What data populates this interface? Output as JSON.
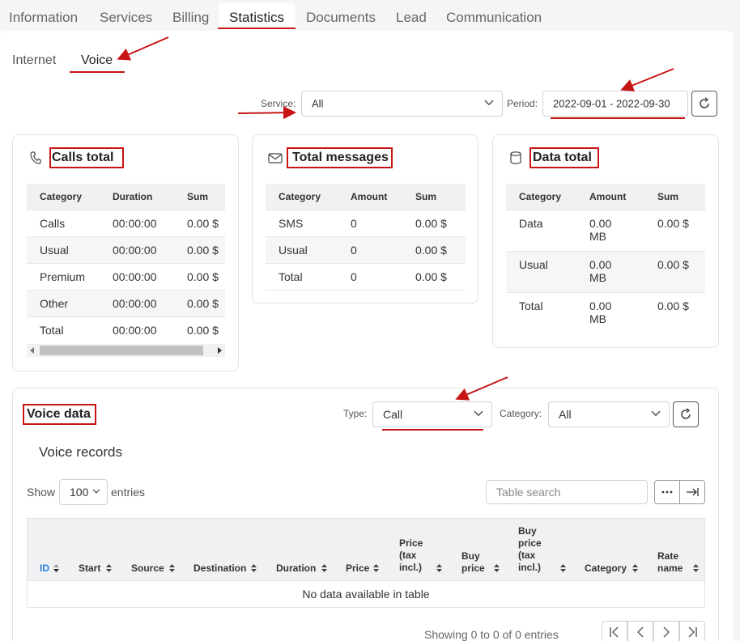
{
  "top_tabs": [
    "Information",
    "Services",
    "Billing",
    "Statistics",
    "Documents",
    "Lead",
    "Communication"
  ],
  "sub_tabs": [
    "Internet",
    "Voice"
  ],
  "filters": {
    "service_label": "Service:",
    "service_value": "All",
    "period_label": "Period:",
    "period_value": "2022-09-01 - 2022-09-30"
  },
  "calls_card": {
    "title": "Calls total",
    "icon": "phone-icon",
    "headers": [
      "Category",
      "Duration",
      "Sum"
    ],
    "rows": [
      [
        "Calls",
        "00:00:00",
        "0.00 $"
      ],
      [
        "Usual",
        "00:00:00",
        "0.00 $"
      ],
      [
        "Premium",
        "00:00:00",
        "0.00 $"
      ],
      [
        "Other",
        "00:00:00",
        "0.00 $"
      ],
      [
        "Total",
        "00:00:00",
        "0.00 $"
      ]
    ]
  },
  "messages_card": {
    "title": "Total messages",
    "icon": "envelope-icon",
    "headers": [
      "Category",
      "Amount",
      "Sum"
    ],
    "rows": [
      [
        "SMS",
        "0",
        "0.00 $"
      ],
      [
        "Usual",
        "0",
        "0.00 $"
      ],
      [
        "Total",
        "0",
        "0.00 $"
      ]
    ]
  },
  "data_card": {
    "title": "Data total",
    "icon": "database-icon",
    "headers": [
      "Category",
      "Amount",
      "Sum"
    ],
    "rows": [
      [
        "Data",
        "0.00 MB",
        "0.00 $"
      ],
      [
        "Usual",
        "0.00 MB",
        "0.00 $"
      ],
      [
        "Total",
        "0.00 MB",
        "0.00 $"
      ]
    ]
  },
  "voice_data": {
    "title": "Voice data",
    "type_label": "Type:",
    "type_value": "Call",
    "category_label": "Category:",
    "category_value": "All",
    "records_title": "Voice records",
    "show_label": "Show",
    "show_value": "100",
    "entries_label": "entries",
    "search_placeholder": "Table search",
    "columns": [
      "ID",
      "Start",
      "Source",
      "Destination",
      "Duration",
      "Price",
      "Price (tax incl.)",
      "Buy price",
      "Buy price (tax incl.)",
      "Category",
      "Rate name"
    ],
    "empty_message": "No data available in table",
    "footer_info": "Showing 0 to 0 of 0 entries"
  },
  "colors": {
    "annotation": "#c81414",
    "link": "#2b7bd6"
  }
}
